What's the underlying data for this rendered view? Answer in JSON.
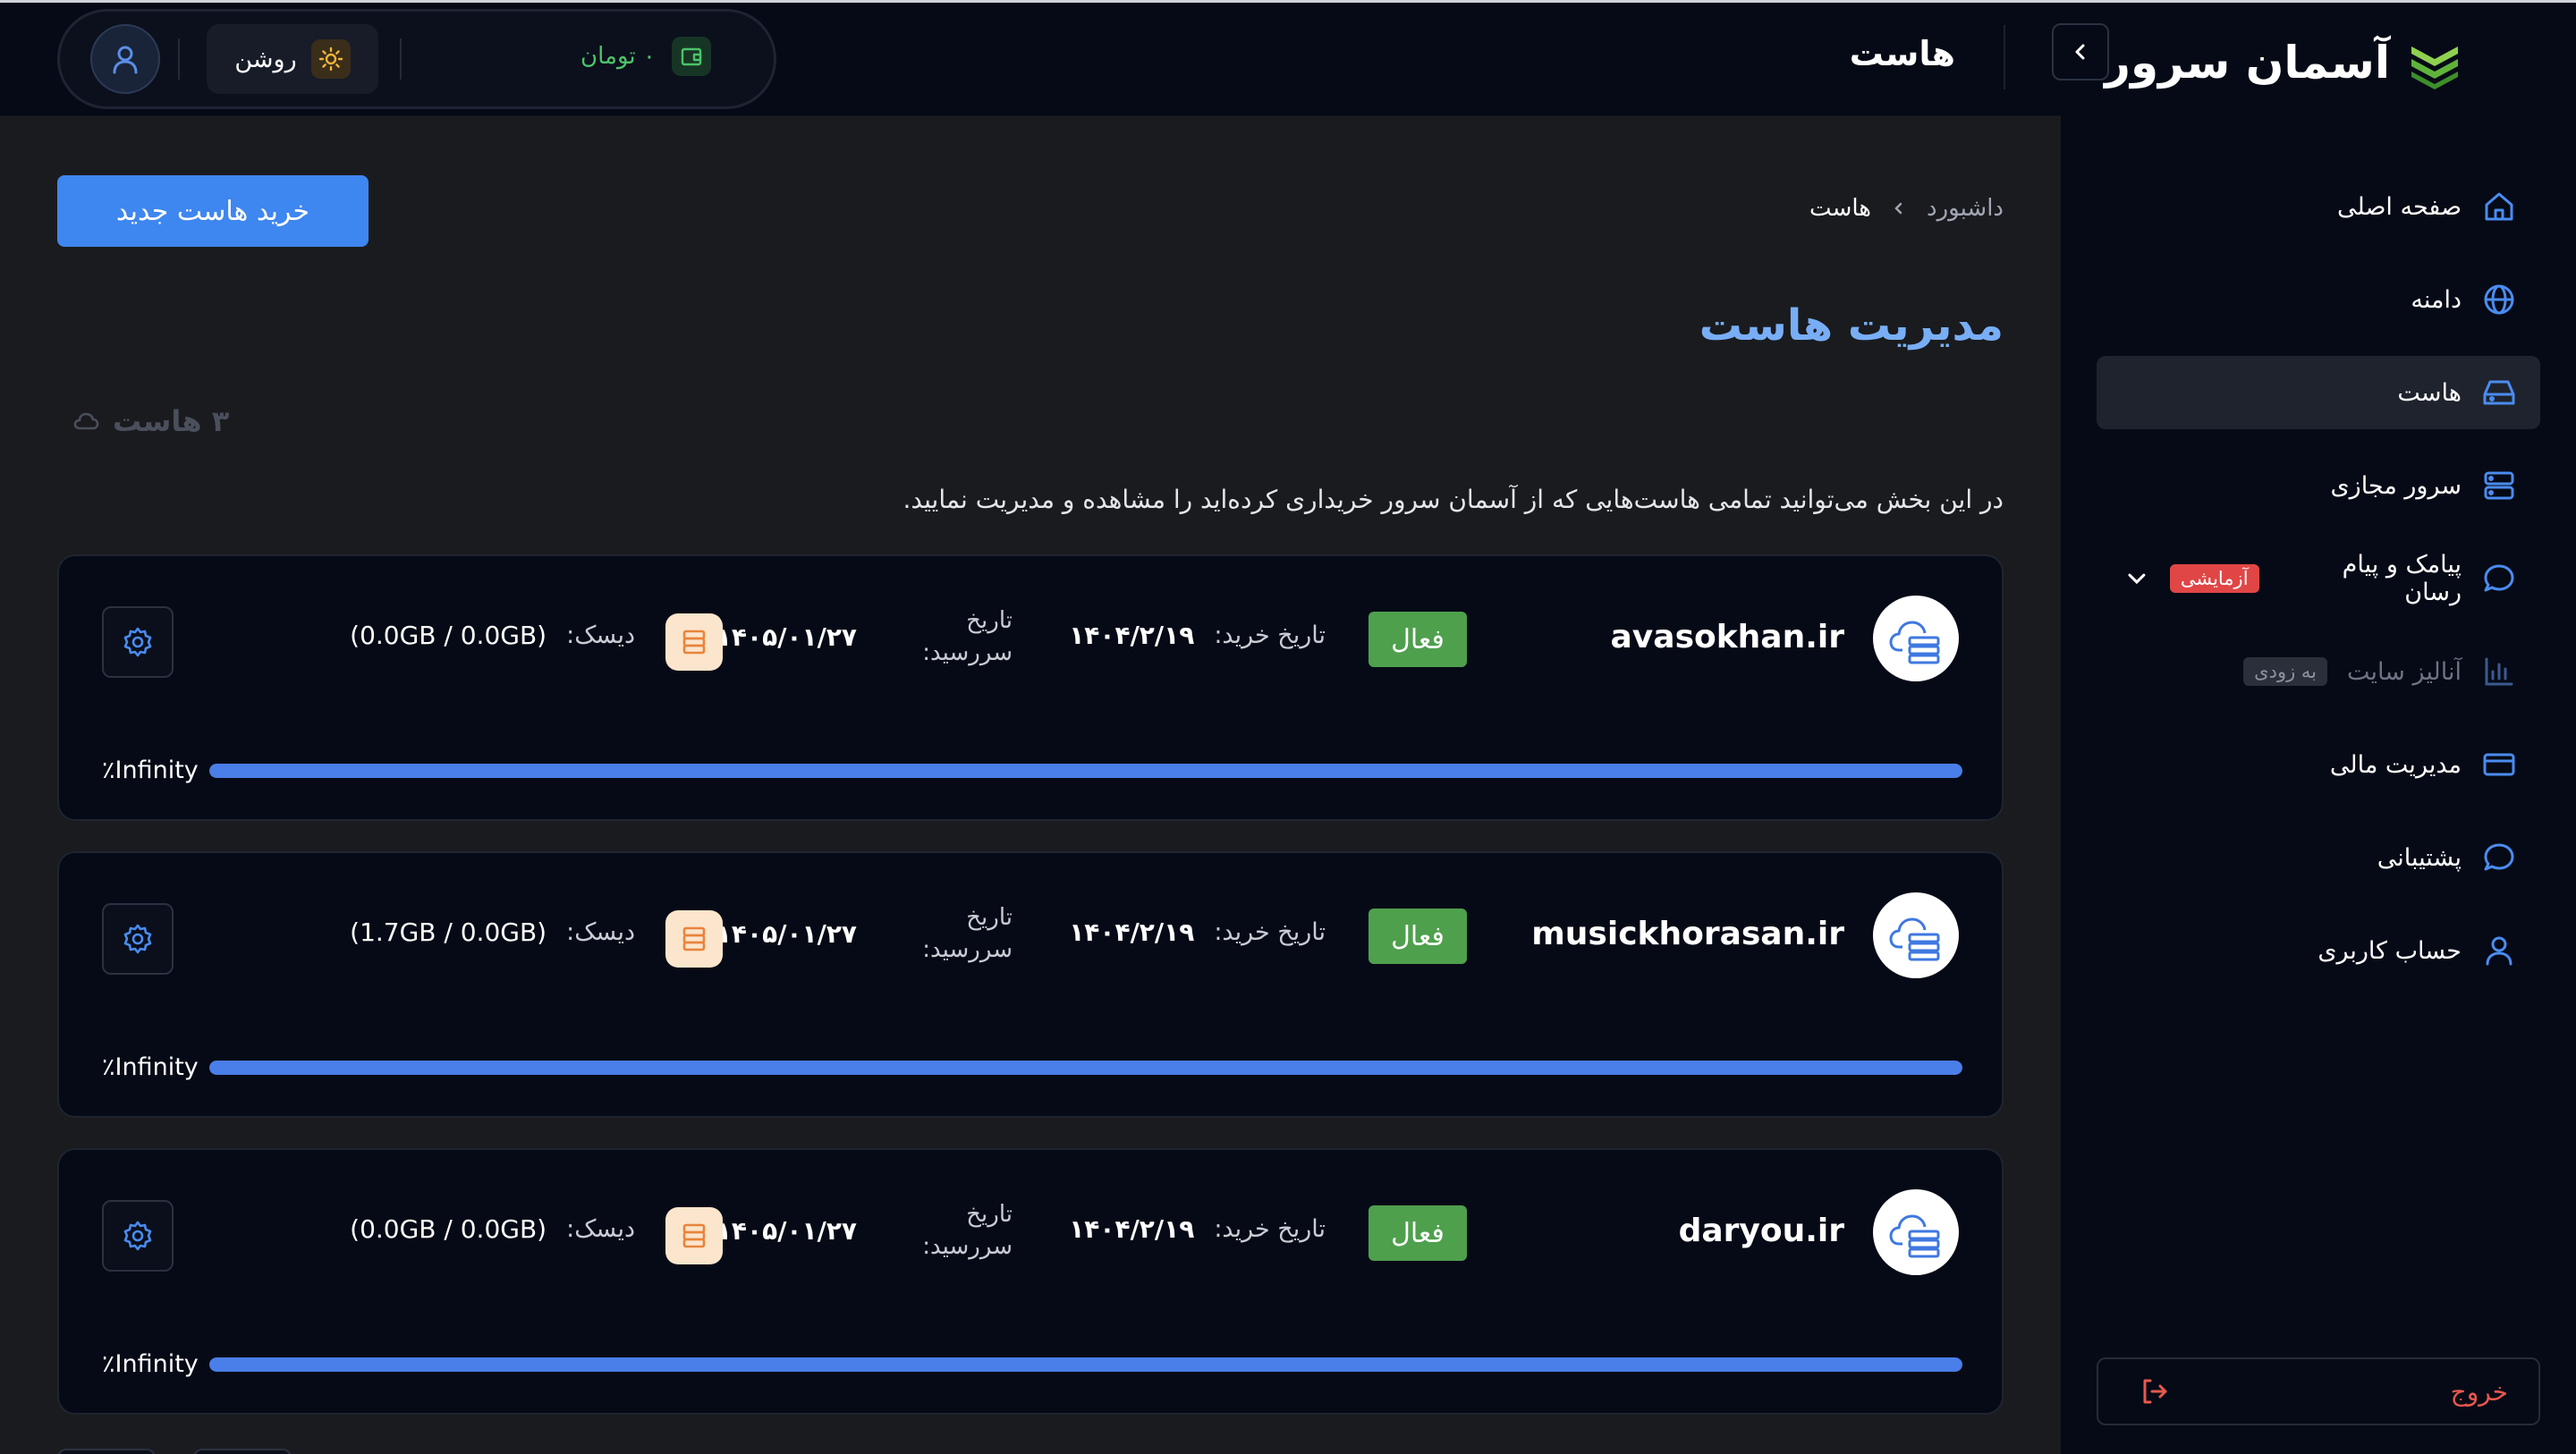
{
  "brand": {
    "name": "آسمان سرور"
  },
  "header": {
    "title": "هاست",
    "theme_label": "روشن",
    "wallet_label": "۰ تومان"
  },
  "sidebar": {
    "items": [
      {
        "label": "صفحه اصلی",
        "icon": "home-icon"
      },
      {
        "label": "دامنه",
        "icon": "globe-icon"
      },
      {
        "label": "هاست",
        "icon": "drive-icon",
        "active": true
      },
      {
        "label": "سرور مجازی",
        "icon": "server-icon"
      },
      {
        "label": "پیامک و پیام رسان",
        "icon": "chat-icon",
        "badge": "آزمایشی"
      },
      {
        "label": "آنالیز سایت",
        "icon": "chart-icon",
        "badge": "به زودی",
        "disabled": true
      },
      {
        "label": "مدیریت مالی",
        "icon": "card-icon"
      },
      {
        "label": "پشتیبانی",
        "icon": "support-icon"
      },
      {
        "label": "حساب کاربری",
        "icon": "user-icon"
      }
    ],
    "logout_label": "خروج"
  },
  "main": {
    "breadcrumb": {
      "root": "داشبورد",
      "current": "هاست"
    },
    "buy_button": "خرید هاست جدید",
    "title": "مدیریت هاست",
    "count_label": "۳ هاست",
    "description": "در این بخش می‌توانید تمامی هاست‌هایی که از آسمان سرور خریداری کرده‌اید را مشاهده و مدیریت نمایید."
  },
  "labels": {
    "purchase_date": "تاریخ خرید:",
    "expire_date_line1": "تاریخ",
    "expire_date_line2": "سررسید:",
    "disk": "دیسک:"
  },
  "hosts": [
    {
      "domain": "avasokhan.ir",
      "status": "فعال",
      "purchase_date": "۱۴۰۴/۲/۱۹",
      "expire_date": "۱۴۰۵/۰۱/۲۷",
      "disk": "(0.0GB / 0.0GB)",
      "progress_text": "Infinity٪",
      "progress": 1.0
    },
    {
      "domain": "musickhorasan.ir",
      "status": "فعال",
      "purchase_date": "۱۴۰۴/۲/۱۹",
      "expire_date": "۱۴۰۵/۰۱/۲۷",
      "disk": "(1.7GB / 0.0GB)",
      "progress_text": "Infinity٪",
      "progress": 1.0
    },
    {
      "domain": "daryou.ir",
      "status": "فعال",
      "purchase_date": "۱۴۰۴/۲/۱۹",
      "expire_date": "۱۴۰۵/۰۱/۲۷",
      "disk": "(0.0GB / 0.0GB)",
      "progress_text": "Infinity٪",
      "progress": 1.0
    }
  ],
  "colors": {
    "accent": "#3e86f0",
    "title": "#78aef5",
    "status_active": "#4ea04d",
    "danger": "#e04646",
    "wallet": "#4cc46a"
  }
}
